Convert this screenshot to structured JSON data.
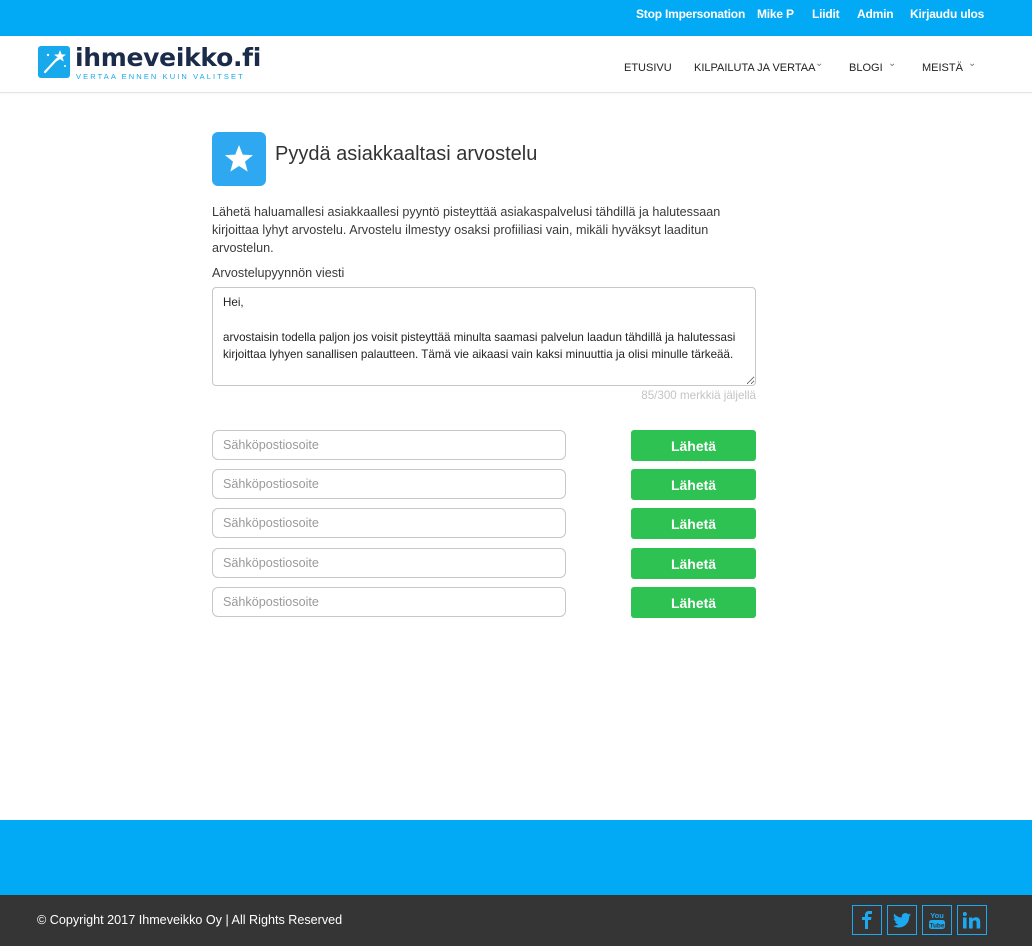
{
  "topbar": {
    "links": [
      "Stop Impersonation",
      "Mike P",
      "Liidit",
      "Admin",
      "Kirjaudu ulos"
    ]
  },
  "header": {
    "logo_text": "ihmeveikko.fi",
    "logo_subtitle": "VERTAA ENNEN KUIN VALITSET",
    "nav": [
      {
        "label": "ETUSIVU",
        "has_dropdown": false
      },
      {
        "label": "KILPAILUTA JA VERTAA",
        "has_dropdown": true
      },
      {
        "label": "BLOGI",
        "has_dropdown": true
      },
      {
        "label": "MEISTÄ",
        "has_dropdown": true
      }
    ]
  },
  "main": {
    "title": "Pyydä asiakkaaltasi arvostelu",
    "title_icon": "star-icon",
    "intro": "Lähetä haluamallesi asiakkaallesi pyyntö pisteyttää asiakaspalvelusi tähdillä  ja halutessaan kirjoittaa lyhyt arvostelu. Arvostelu ilmestyy osaksi profiiliasi vain, mikäli hyväksyt laaditun arvostelun.",
    "message_label": "Arvostelupyynnön viesti",
    "message_value": "Hei,\n\narvostaisin todella paljon jos voisit pisteyttää minulta saamasi palvelun laadun tähdillä ja halutessasi kirjoittaa lyhyen sanallisen palautteen. Tämä vie aikaasi vain kaksi minuuttia ja olisi minulle tärkeää.",
    "char_counter": "85/300 merkkiä jäljellä",
    "email_placeholder": "Sähköpostiosoite",
    "send_label": "Lähetä",
    "rows": 5
  },
  "footer": {
    "copyright": "© Copyright 2017 Ihmeveikko Oy | All Rights Reserved",
    "social": [
      "facebook-icon",
      "twitter-icon",
      "youtube-icon",
      "linkedin-icon"
    ]
  },
  "colors": {
    "brand_blue": "#02a9f4",
    "send_green": "#2ec253",
    "footer_dark": "#353535"
  }
}
